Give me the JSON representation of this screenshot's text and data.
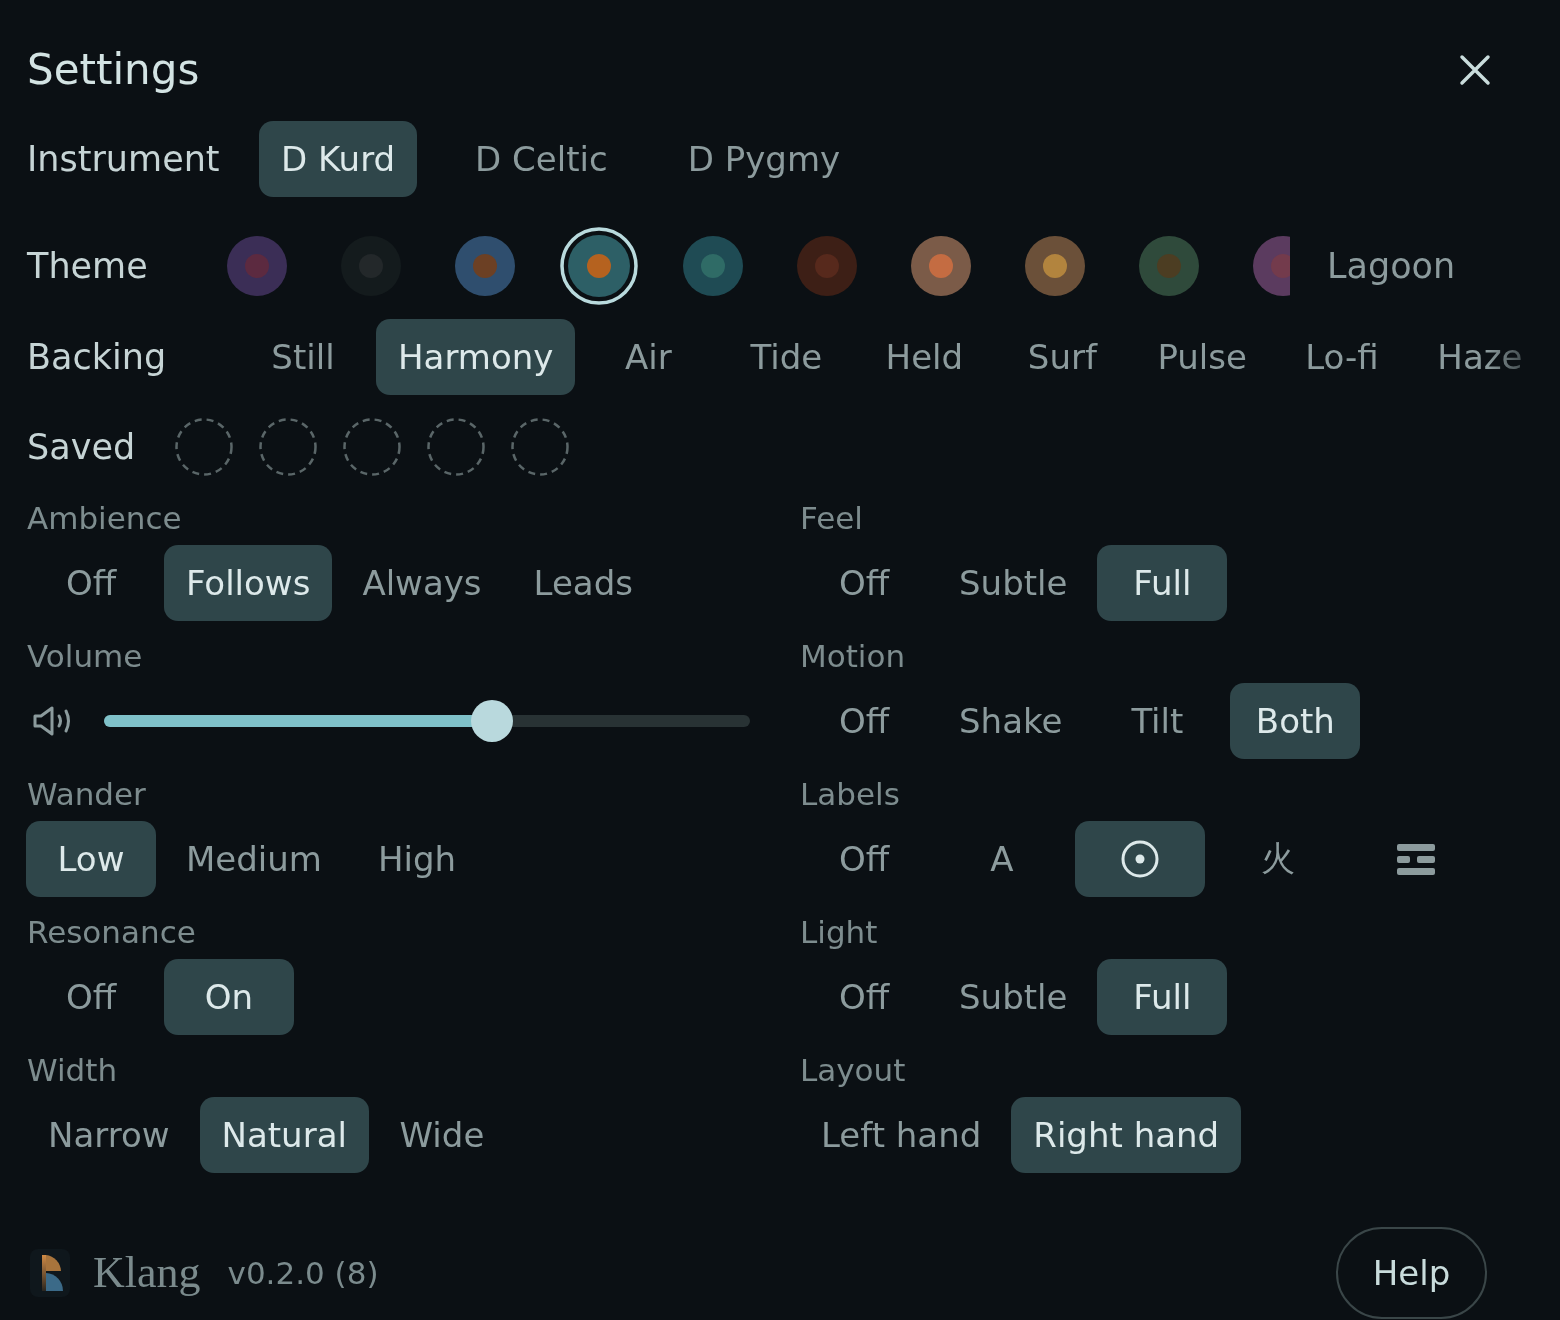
{
  "header": {
    "title": "Settings"
  },
  "instrument": {
    "label": "Instrument",
    "options": [
      {
        "label": "D Kurd",
        "selected": true
      },
      {
        "label": "D Celtic",
        "selected": false
      },
      {
        "label": "D Pygmy",
        "selected": false
      }
    ]
  },
  "theme": {
    "label": "Theme",
    "swatches": [
      {
        "color": "#3b2e56",
        "center": {
          "color": "#5c2a40"
        },
        "selected": false
      },
      {
        "color": "#141b1d",
        "center": {
          "color": "#23282a"
        },
        "selected": false
      },
      {
        "color": "#2f4e6e",
        "center": {
          "color": "#6c4024"
        },
        "selected": false
      },
      {
        "color": "#2d5f66",
        "center": {
          "color": "#b5621f"
        },
        "selected": true
      },
      {
        "color": "#1f4b54",
        "center": {
          "color": "#2f6b66"
        },
        "selected": false
      },
      {
        "color": "#3d1f16",
        "center": {
          "color": "#57291c"
        },
        "selected": false
      },
      {
        "color": "#7b5b48",
        "center": {
          "color": "#c46c42"
        },
        "selected": false
      },
      {
        "color": "#6b5039",
        "center": {
          "color": "#b2843e"
        },
        "selected": false
      },
      {
        "color": "#2f4a3b",
        "center": {
          "color": "#4c3d22"
        },
        "selected": false
      },
      {
        "color": "#5b3b5f",
        "center": {
          "color": "#733b4c"
        },
        "selected": false
      }
    ],
    "current_name": "Lagoon"
  },
  "backing": {
    "label": "Backing",
    "options": [
      {
        "label": "Still",
        "selected": false
      },
      {
        "label": "Harmony",
        "selected": true
      },
      {
        "label": "Air",
        "selected": false
      },
      {
        "label": "Tide",
        "selected": false
      },
      {
        "label": "Held",
        "selected": false
      },
      {
        "label": "Surf",
        "selected": false
      },
      {
        "label": "Pulse",
        "selected": false
      },
      {
        "label": "Lo-fi",
        "selected": false
      },
      {
        "label": "Haze",
        "selected": false
      }
    ]
  },
  "saved": {
    "label": "Saved",
    "slots": [
      {
        "filled": false
      },
      {
        "filled": false
      },
      {
        "filled": false
      },
      {
        "filled": false
      },
      {
        "filled": false
      }
    ]
  },
  "settings_left": [
    {
      "label": "Ambience",
      "kind": "choice",
      "options": [
        {
          "label": "Off",
          "selected": false
        },
        {
          "label": "Follows",
          "selected": true
        },
        {
          "label": "Always",
          "selected": false
        },
        {
          "label": "Leads",
          "selected": false
        }
      ]
    },
    {
      "label": "Volume",
      "kind": "slider",
      "level": 0.6
    },
    {
      "label": "Wander",
      "kind": "choice",
      "options": [
        {
          "label": "Low",
          "selected": true
        },
        {
          "label": "Medium",
          "selected": false
        },
        {
          "label": "High",
          "selected": false
        }
      ]
    },
    {
      "label": "Resonance",
      "kind": "choice",
      "options": [
        {
          "label": "Off",
          "selected": false
        },
        {
          "label": "On",
          "selected": true
        }
      ]
    },
    {
      "label": "Width",
      "kind": "choice",
      "options": [
        {
          "label": "Narrow",
          "selected": false
        },
        {
          "label": "Natural",
          "selected": true
        },
        {
          "label": "Wide",
          "selected": false
        }
      ]
    }
  ],
  "settings_right": [
    {
      "label": "Feel",
      "kind": "choice",
      "options": [
        {
          "label": "Off",
          "selected": false
        },
        {
          "label": "Subtle",
          "selected": false
        },
        {
          "label": "Full",
          "selected": true
        }
      ]
    },
    {
      "label": "Motion",
      "kind": "choice",
      "options": [
        {
          "label": "Off",
          "selected": false
        },
        {
          "label": "Shake",
          "selected": false
        },
        {
          "label": "Tilt",
          "selected": false
        },
        {
          "label": "Both",
          "selected": true
        }
      ]
    },
    {
      "label": "Labels",
      "kind": "choice",
      "options": [
        {
          "kind": "text",
          "label": "Off",
          "selected": false
        },
        {
          "kind": "text",
          "label": "A",
          "selected": false
        },
        {
          "kind": "dot",
          "selected": true
        },
        {
          "kind": "text",
          "label": "火",
          "selected": false
        },
        {
          "kind": "lines",
          "selected": false
        }
      ]
    },
    {
      "label": "Light",
      "kind": "choice",
      "options": [
        {
          "label": "Off",
          "selected": false
        },
        {
          "label": "Subtle",
          "selected": false
        },
        {
          "label": "Full",
          "selected": true
        }
      ]
    },
    {
      "label": "Layout",
      "kind": "choice",
      "options": [
        {
          "label": "Left hand",
          "selected": false
        },
        {
          "label": "Right hand",
          "selected": true
        }
      ]
    }
  ],
  "footer": {
    "app_name": "Klang",
    "version": "v0.2.0 (8)",
    "help_button": "Help"
  }
}
